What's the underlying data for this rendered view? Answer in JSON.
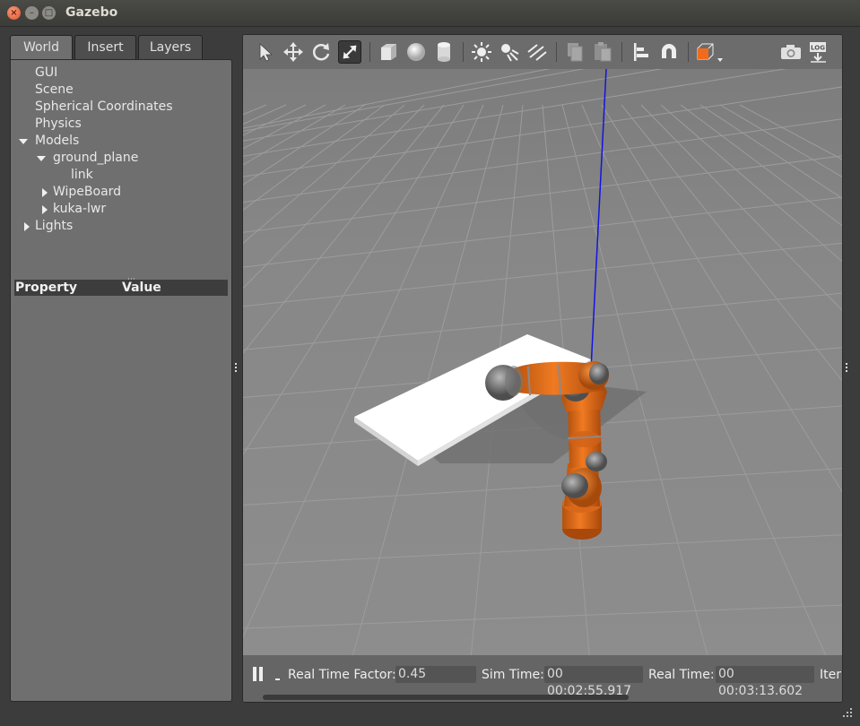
{
  "window": {
    "title": "Gazebo"
  },
  "tabs": [
    {
      "label": "World",
      "active": true
    },
    {
      "label": "Insert",
      "active": false
    },
    {
      "label": "Layers",
      "active": false
    }
  ],
  "tree": {
    "gui": "GUI",
    "scene": "Scene",
    "spherical": "Spherical Coordinates",
    "physics": "Physics",
    "models": "Models",
    "ground_plane": "ground_plane",
    "link": "link",
    "wipeboard": "WipeBoard",
    "kuka": "kuka-lwr",
    "lights": "Lights"
  },
  "properties": {
    "col_property": "Property",
    "col_value": "Value"
  },
  "toolbar": {
    "tools": [
      "select-arrow-icon",
      "translate-icon",
      "rotate-icon",
      "scale-icon",
      "box-icon",
      "sphere-icon",
      "cylinder-icon",
      "point-light-icon",
      "spot-light-icon",
      "directional-light-icon",
      "copy-icon",
      "paste-icon",
      "align-icon",
      "snap-magnet-icon",
      "view-angle-icon",
      "screenshot-camera-icon",
      "log-icon"
    ],
    "log_label": "LOG"
  },
  "status": {
    "rtf_label": "Real Time Factor:",
    "rtf_value": "0.45",
    "sim_label": "Sim Time:",
    "sim_value": "00 00:02:55.917",
    "real_label": "Real Time:",
    "real_value": "00 00:03:13.602",
    "iter_label": "Iter"
  },
  "colors": {
    "robot": "#e8731f",
    "joint": "#808080",
    "z_axis": "#1414e0",
    "board": "#ffffff"
  }
}
